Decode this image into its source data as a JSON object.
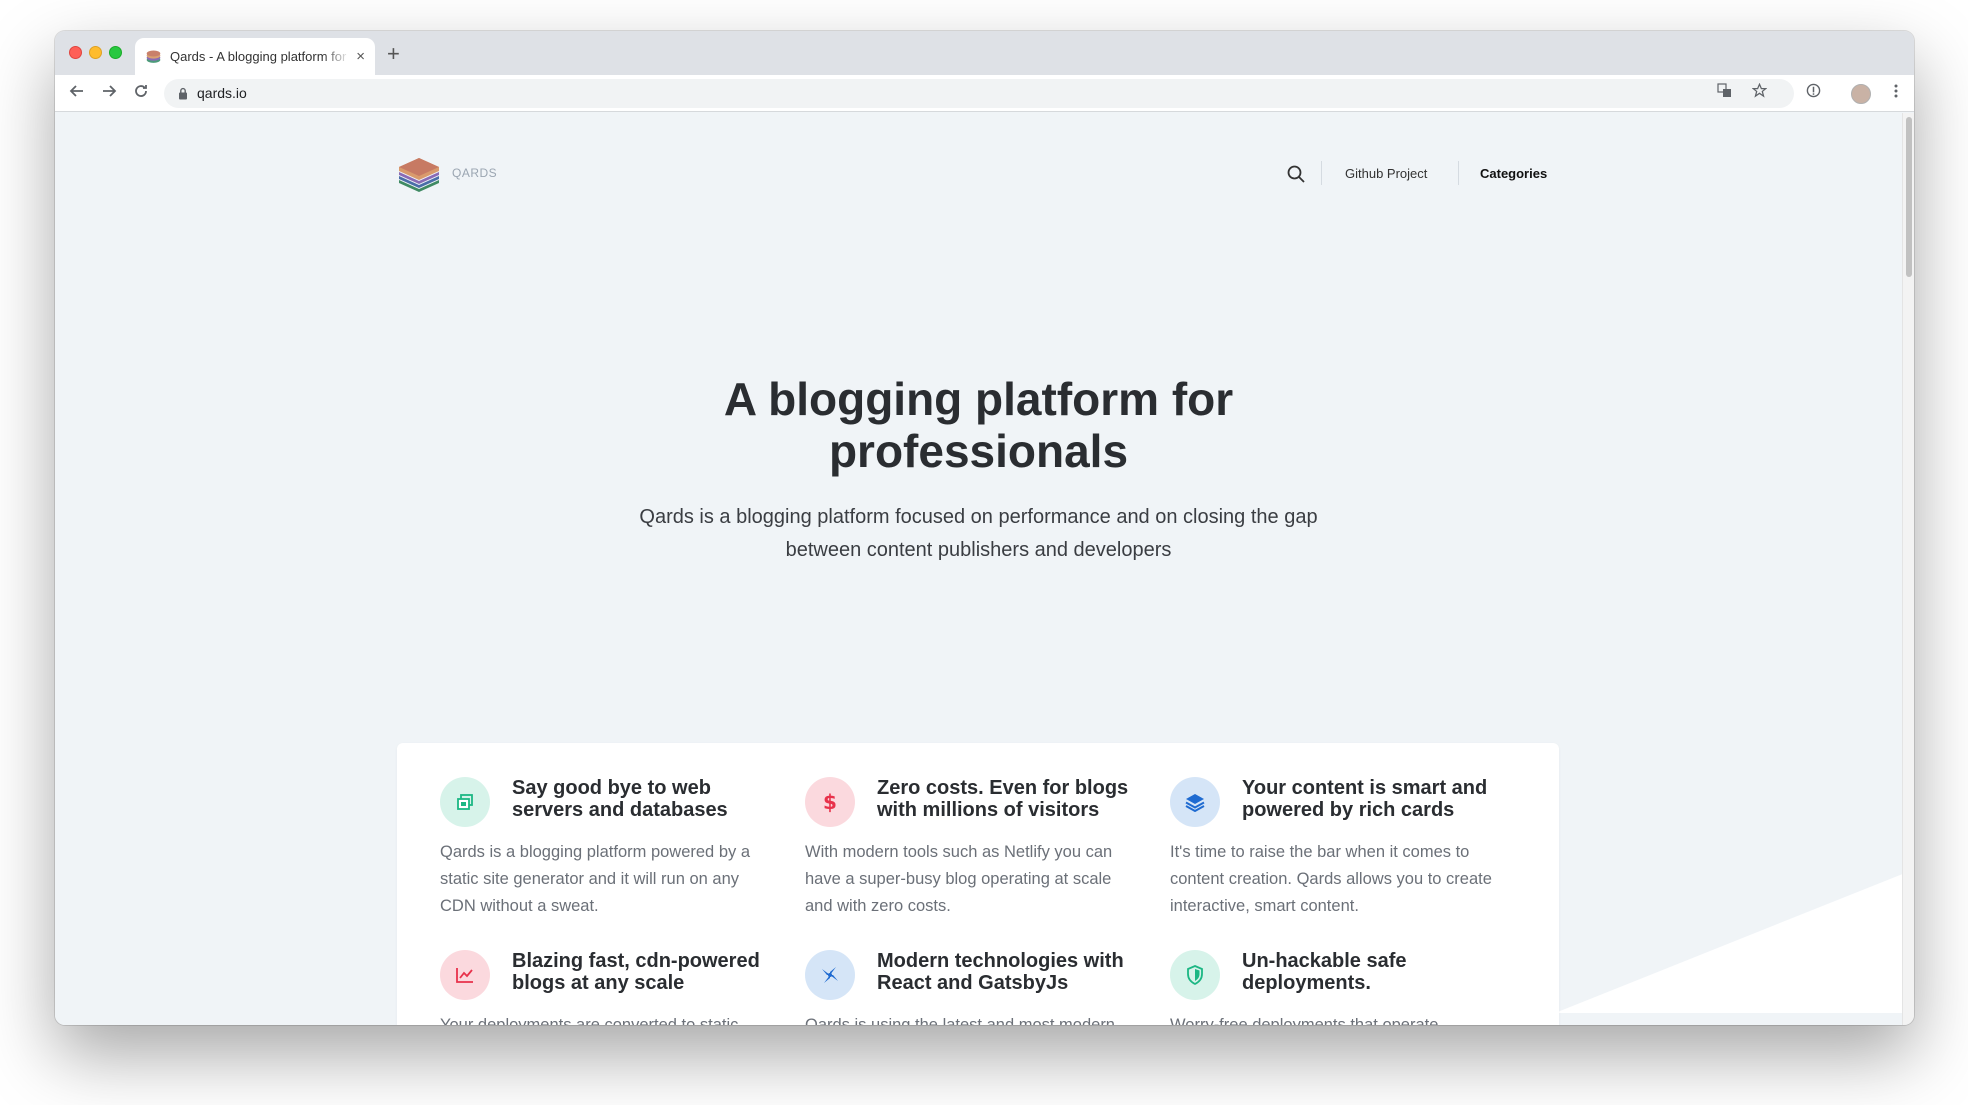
{
  "browser": {
    "tab_title": "Qards - A blogging platform for professionals",
    "tab_close": "×",
    "new_tab": "+",
    "url": "qards.io"
  },
  "header": {
    "brand": "QARDS",
    "nav": {
      "github": "Github Project",
      "categories": "Categories"
    }
  },
  "hero": {
    "title_line1": "A blogging platform for",
    "title_line2": "professionals",
    "subtitle_line1": "Qards is a blogging platform focused on performance and on closing the gap",
    "subtitle_line2": "between content publishers and developers"
  },
  "features": [
    {
      "icon": "window-stack-icon",
      "color": "#1cb784",
      "bg": "#d7f3ea",
      "title_line1": "Say good bye to web",
      "title_line2": "servers and databases",
      "text": "Qards is a blogging platform powered by a static site generator and it will run on any CDN without a sweat."
    },
    {
      "icon": "dollar-icon",
      "color": "#e8324b",
      "bg": "#fbd9de",
      "title_line1": "Zero costs. Even for blogs",
      "title_line2": "with millions of visitors",
      "text": "With modern tools such as Netlify you can have a super-busy blog operating at scale and with zero costs."
    },
    {
      "icon": "layers-icon",
      "color": "#1f6bd1",
      "bg": "#d5e5f7",
      "title_line1": "Your content is smart and",
      "title_line2": "powered by rich cards",
      "text": "It's time to raise the bar when it comes to content creation. Qards allows you to create interactive, smart content."
    },
    {
      "icon": "line-chart-icon",
      "color": "#e8324b",
      "bg": "#fbd9de",
      "title_line1": "Blazing fast, cdn-powered",
      "title_line2": "blogs at any scale",
      "text": "Your deployments are converted to static"
    },
    {
      "icon": "react-icon",
      "color": "#1f6bd1",
      "bg": "#d5e5f7",
      "title_line1": "Modern technologies with",
      "title_line2": "React and GatsbyJs",
      "text": "Qards is using the latest and most modern"
    },
    {
      "icon": "shield-icon",
      "color": "#1cb784",
      "bg": "#d7f3ea",
      "title_line1": "Un-hackable safe",
      "title_line2": "deployments.",
      "text": "Worry-free deployments that operate"
    }
  ]
}
